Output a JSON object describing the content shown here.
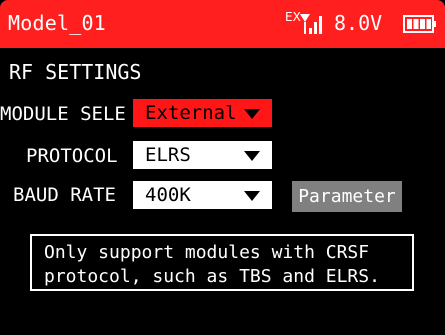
{
  "header": {
    "model_name": "Model_01",
    "signal_prefix": "EX",
    "voltage": "8.0V",
    "icons": {
      "signal": "signal-strength-icon",
      "battery": "battery-icon"
    },
    "colors": {
      "bar": "#ff1f1f",
      "text": "#ffffff"
    }
  },
  "section": {
    "title": "RF SETTINGS"
  },
  "rows": {
    "module": {
      "label": "MODULE SELE",
      "value": "External"
    },
    "protocol": {
      "label": "PROTOCOL",
      "value": "ELRS"
    },
    "baud_rate": {
      "label": "BAUD RATE",
      "value": "400K"
    }
  },
  "buttons": {
    "parameter": "Parameter"
  },
  "info": {
    "text": "Only support modules with CRSF\nprotocol, such as TBS and ELRS."
  }
}
